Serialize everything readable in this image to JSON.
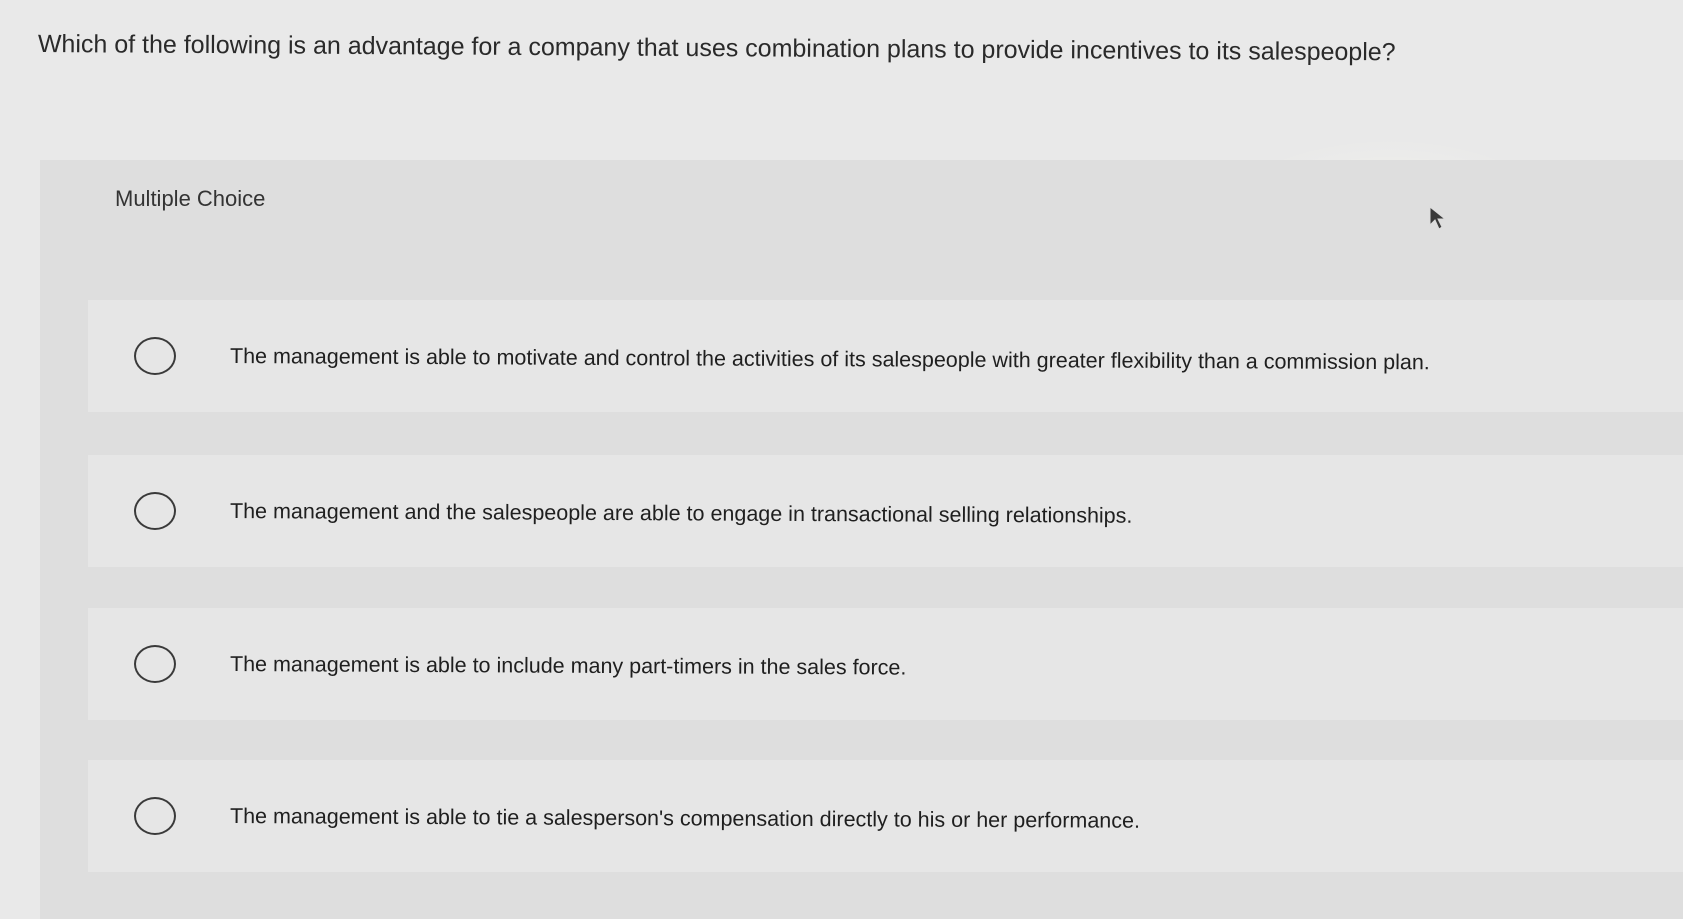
{
  "question": {
    "text": "Which of the following is an advantage for a company that uses combination plans to provide incentives to its salespeople?"
  },
  "section": {
    "label": "Multiple Choice"
  },
  "options": [
    {
      "label": "The management is able to motivate and control the activities of its salespeople with greater flexibility than a commission plan."
    },
    {
      "label": "The management and the salespeople are able to engage in transactional selling relationships."
    },
    {
      "label": "The management is able to include many part-timers in the sales force."
    },
    {
      "label": "The management is able to tie a salesperson's compensation directly to his or her performance."
    }
  ],
  "icons": {
    "pointer": "mouse-pointer-icon",
    "radio": "radio-button-icon"
  },
  "colors": {
    "background": "#e9e9e9",
    "panel": "#dedede",
    "option": "#e6e6e6",
    "text": "#222222"
  }
}
